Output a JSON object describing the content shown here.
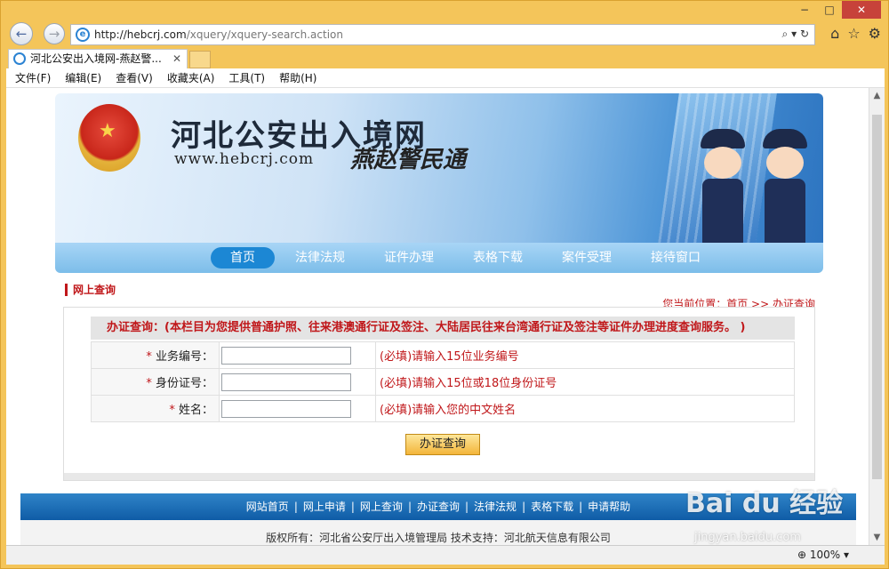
{
  "browser": {
    "url_host": "http://hebcrj.com",
    "url_path": "/xquery/xquery-search.action",
    "tab_title": "河北公安出入境网-燕赵警...",
    "zoom": "100%",
    "menu": [
      "文件(F)",
      "编辑(E)",
      "查看(V)",
      "收藏夹(A)",
      "工具(T)",
      "帮助(H)"
    ],
    "window_controls": [
      "−",
      "□",
      "✕"
    ]
  },
  "banner": {
    "title": "河北公安出入境网",
    "url": "www.hebcrj.com",
    "slogan": "燕赵警民通"
  },
  "nav": {
    "items": [
      "首页",
      "法律法规",
      "证件办理",
      "表格下载",
      "案件受理",
      "接待窗口"
    ],
    "active": "首页"
  },
  "section": {
    "title": "网上查询",
    "breadcrumb_prefix": "您当前位置：首页 >> ",
    "breadcrumb_current": "办证查询"
  },
  "form": {
    "header": "办证查询：(本栏目为您提供普通护照、往来港澳通行证及签注、大陆居民往来台湾通行证及签注等证件办理进度查询服务。 )",
    "fields": [
      {
        "label": "业务编号：",
        "value": "",
        "hint": "(必填)请输入15位业务编号"
      },
      {
        "label": "身份证号：",
        "value": "",
        "hint": "(必填)请输入15位或18位身份证号"
      },
      {
        "label": "姓名：",
        "value": "",
        "hint": "(必填)请输入您的中文姓名"
      }
    ],
    "required_mark": "*",
    "submit": "办证查询"
  },
  "footer": {
    "links": [
      "网站首页",
      "网上申请",
      "网上查询",
      "办证查询",
      "法律法规",
      "表格下载",
      "申请帮助"
    ],
    "copyright": "版权所有：河北省公安厅出入境管理局 技术支持：河北航天信息有限公司"
  },
  "watermark": {
    "brand": "Bai du 经验",
    "url": "jingyan.baidu.com"
  }
}
